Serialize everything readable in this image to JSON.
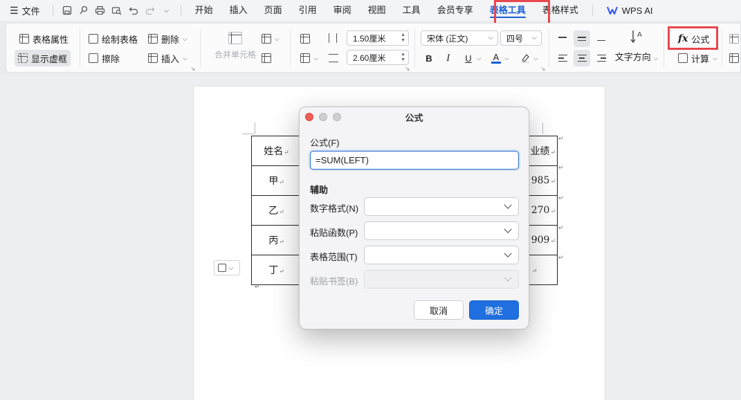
{
  "menubar": {
    "file_label": "文件",
    "tabs": [
      "开始",
      "插入",
      "页面",
      "引用",
      "审阅",
      "视图",
      "工具",
      "会员专享",
      "表格工具",
      "表格样式"
    ],
    "active_tab": "表格工具",
    "wps_ai_label": "WPS AI"
  },
  "ribbon": {
    "table_properties": "表格属性",
    "show_gridlines": "显示虚框",
    "draw_table": "绘制表格",
    "delete": "删除",
    "erase": "擦除",
    "insert": "插入",
    "merge_cells": "合并单元格",
    "row_height": "1.50厘米",
    "col_width": "2.60厘米",
    "font_name": "宋体 (正文)",
    "font_size": "四号",
    "bold": "B",
    "italic": "I",
    "underline": "U",
    "font_color_glyph": "A",
    "text_direction": "文字方向",
    "formula": "公式",
    "formula_glyph": "fx",
    "calculate": "计算"
  },
  "table": {
    "header_left": "姓名",
    "header_right": "业绩",
    "rows": [
      {
        "name": "甲",
        "value": "985"
      },
      {
        "name": "乙",
        "value": "270"
      },
      {
        "name": "丙",
        "value": "909"
      },
      {
        "name": "丁",
        "value": ""
      }
    ],
    "para_mark": "↵"
  },
  "dialog": {
    "title": "公式",
    "formula_label": "公式(F)",
    "formula_value": "=SUM(LEFT)",
    "section_label": "辅助",
    "number_format_label": "数字格式(N)",
    "paste_function_label": "粘贴函数(P)",
    "table_range_label": "表格范围(T)",
    "paste_bookmark_label": "粘贴书签(B)",
    "cancel_label": "取消",
    "ok_label": "确定"
  },
  "colors": {
    "accent": "#1a5fd6",
    "highlight_box": "#e8474d",
    "ok_button": "#1f6fe0",
    "close_dot": "#ee5f57",
    "inactive_dot": "#c9c9cc"
  }
}
